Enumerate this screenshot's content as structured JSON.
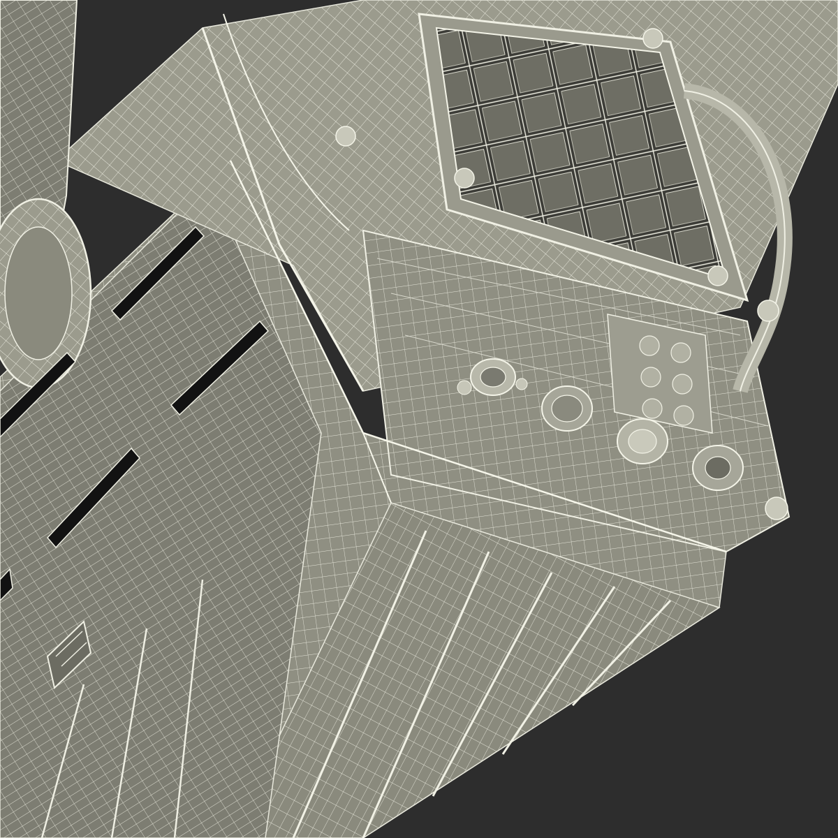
{
  "scene": {
    "subject": "wireframe-3d-render",
    "colors": {
      "background": "#2d2d2d",
      "body_fill": "#8f8f82",
      "body_light": "#a9a99b",
      "body_dark": "#6f6f64",
      "wire": "#e8e8dc",
      "slot": "#151515"
    }
  }
}
